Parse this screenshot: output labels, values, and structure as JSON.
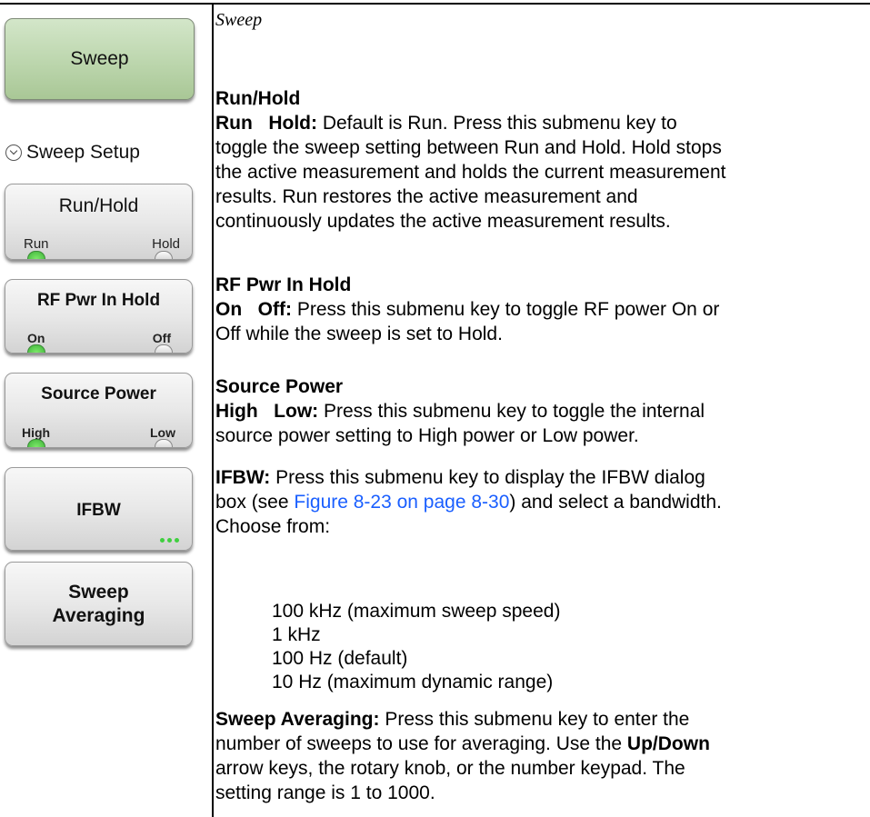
{
  "page_heading": "Sweep",
  "menu": {
    "title_key": "Sweep",
    "section": "Sweep Setup",
    "keys": [
      {
        "label": "Run/Hold",
        "option_left": "Run",
        "option_right": "Hold",
        "active": "left"
      },
      {
        "label": "RF Pwr In Hold",
        "option_left": "On",
        "option_right": "Off",
        "active": "left"
      },
      {
        "label": "Source Power",
        "option_left": "High",
        "option_right": "Low",
        "active": "left"
      },
      {
        "label": "IFBW",
        "more_indicator": true
      },
      {
        "label_line1": "Sweep",
        "label_line2": "Averaging"
      }
    ]
  },
  "items": {
    "run_hold": {
      "heading": "Run/Hold",
      "keyword": "Run   Hold:",
      "text_l1": " Default is Run. Press this submenu key to",
      "text_l2": "toggle the sweep setting between Run and Hold. Hold stops",
      "text_l3": "the active measurement and holds the current measurement",
      "text_l4": "results. Run restores the active measurement and",
      "text_l5": "continuously updates the active measurement results."
    },
    "rf_pwr": {
      "heading": "RF Pwr In Hold",
      "keyword": "On   Off:",
      "text_l1": " Press this submenu key to toggle RF power On or",
      "text_l2": "Off while the sweep is set to Hold."
    },
    "source_power": {
      "heading": "Source Power",
      "keyword": "High   Low:",
      "text_l1": " Press this submenu key to toggle the internal",
      "text_l2": "source power setting to High power or Low power."
    },
    "ifbw": {
      "keyword": "IFBW:",
      "text_l1": " Press this submenu key to display the IFBW dialog",
      "text_l2a": "box (see ",
      "link": "Figure 8-23 on page 8-30",
      "text_l2b": ") and select a bandwidth.",
      "text_l3": "Choose from:",
      "options": [
        "100 kHz (maximum sweep speed)",
        "1 kHz",
        "100 Hz (default)",
        "10 Hz (maximum dynamic range)"
      ]
    },
    "averaging": {
      "keyword": "Sweep Averaging:",
      "text_l1": " Press this submenu key to enter the",
      "text_l2a": "number of sweeps to use for averaging. Use the ",
      "text_l2b": "Up/Down",
      "text_l3": "arrow keys, the rotary knob, or the number keypad. The",
      "text_l4": "setting range is 1 to 1000."
    }
  }
}
